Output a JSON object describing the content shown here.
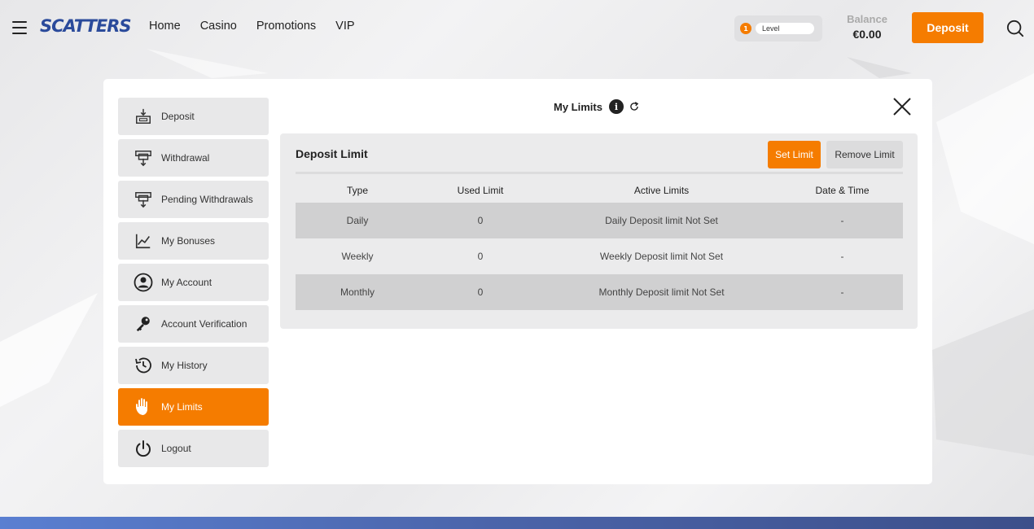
{
  "header": {
    "logo": "SCATTERS",
    "nav": [
      "Home",
      "Casino",
      "Promotions",
      "VIP"
    ],
    "level_badge": "1",
    "level_label": "Level",
    "balance_label": "Balance",
    "balance_value": "€0.00",
    "deposit_label": "Deposit"
  },
  "sidebar": {
    "items": [
      {
        "label": "Deposit",
        "icon": "deposit-icon"
      },
      {
        "label": "Withdrawal",
        "icon": "withdrawal-icon"
      },
      {
        "label": "Pending Withdrawals",
        "icon": "pending-withdrawals-icon"
      },
      {
        "label": "My Bonuses",
        "icon": "chart-line-icon"
      },
      {
        "label": "My Account",
        "icon": "user-circle-icon"
      },
      {
        "label": "Account Verification",
        "icon": "key-icon"
      },
      {
        "label": "My History",
        "icon": "history-icon"
      },
      {
        "label": "My Limits",
        "icon": "hand-icon",
        "active": true
      },
      {
        "label": "Logout",
        "icon": "power-icon"
      }
    ]
  },
  "modal": {
    "title": "My Limits",
    "info_icon": "i",
    "panel": {
      "title": "Deposit Limit",
      "set_limit_label": "Set Limit",
      "remove_limit_label": "Remove Limit",
      "columns": [
        "Type",
        "Used Limit",
        "Active Limits",
        "Date & Time"
      ],
      "rows": [
        [
          "Daily",
          "0",
          "Daily Deposit limit Not Set",
          "-"
        ],
        [
          "Weekly",
          "0",
          "Weekly Deposit limit Not Set",
          "-"
        ],
        [
          "Monthly",
          "0",
          "Monthly Deposit limit Not Set",
          "-"
        ]
      ]
    }
  },
  "colors": {
    "accent": "#f57c00",
    "brand": "#2a4a9b"
  }
}
